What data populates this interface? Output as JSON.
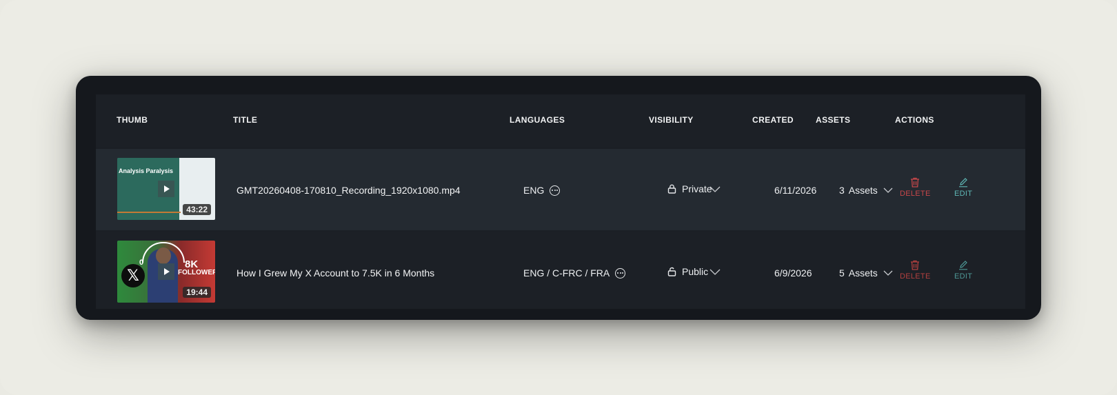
{
  "table": {
    "headers": {
      "thumb": "THUMB",
      "title": "TITLE",
      "languages": "LANGUAGES",
      "visibility": "VISIBILITY",
      "created": "CREATED",
      "assets": "ASSETS",
      "actions": "ACTIONS"
    },
    "rows": [
      {
        "thumb_title": "Analysis Paralysis",
        "duration": "43:22",
        "title": "GMT20260408-170810_Recording_1920x1080.mp4",
        "languages": "ENG",
        "visibility": "Private",
        "created": "6/11/2026",
        "assets_count": "3",
        "assets_label": "Assets",
        "delete_label": "DELETE",
        "edit_label": "EDIT"
      },
      {
        "thumb_text_zero": "0",
        "thumb_text_8k": "8K",
        "thumb_text_followers": "FOLLOWERS",
        "duration": "19:44",
        "title": "How I Grew My X Account to 7.5K in 6 Months",
        "languages": "ENG / C-FRC / FRA",
        "visibility": "Public",
        "created": "6/9/2026",
        "assets_count": "5",
        "assets_label": "Assets",
        "delete_label": "DELETE",
        "edit_label": "EDIT"
      }
    ]
  },
  "colors": {
    "delete": "#c8474a",
    "edit": "#5fb8b6",
    "card_bg": "#15181d"
  }
}
